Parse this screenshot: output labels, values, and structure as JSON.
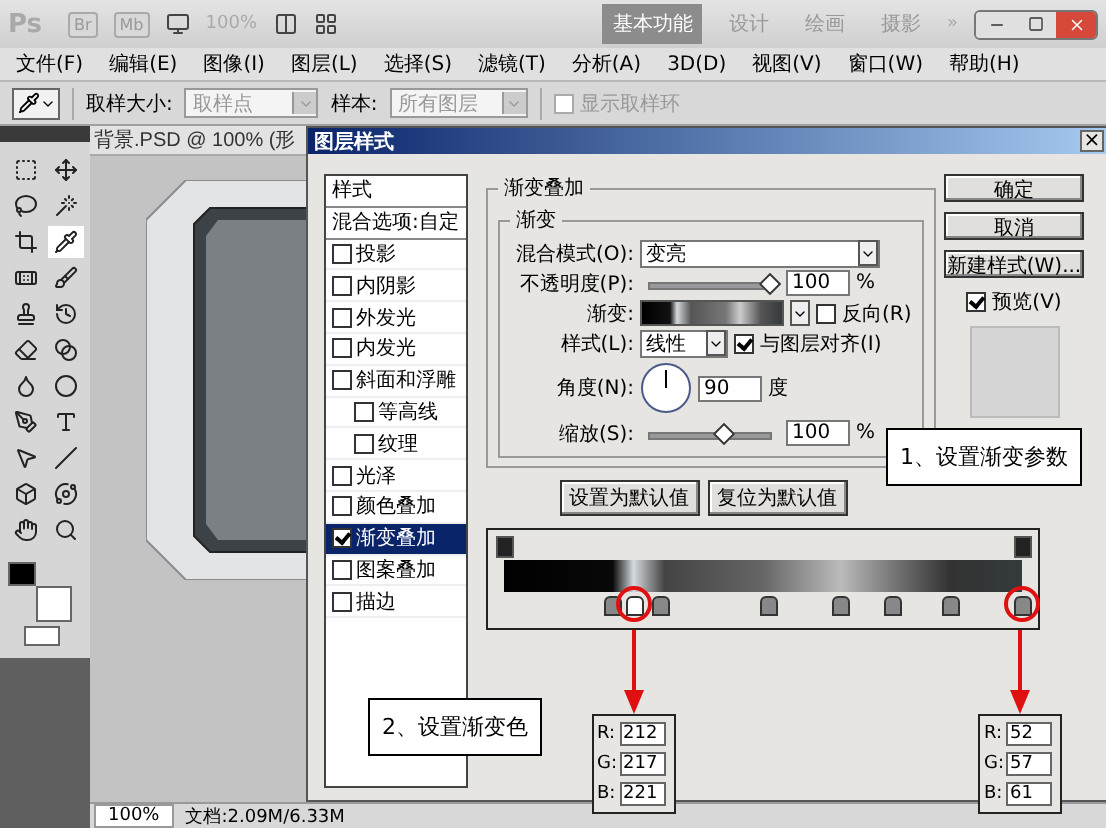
{
  "app_bar": {
    "logo": "Ps",
    "bridge": "Br",
    "mini_bridge": "Mb",
    "zoom": "100%",
    "workspaces": [
      {
        "label": "基本功能",
        "selected": true
      },
      {
        "label": "设计",
        "selected": false
      },
      {
        "label": "绘画",
        "selected": false
      },
      {
        "label": "摄影",
        "selected": false
      }
    ],
    "more": "»"
  },
  "menu": [
    "文件(F)",
    "编辑(E)",
    "图像(I)",
    "图层(L)",
    "选择(S)",
    "滤镜(T)",
    "分析(A)",
    "3D(D)",
    "视图(V)",
    "窗口(W)",
    "帮助(H)"
  ],
  "options_bar": {
    "sample_size_label": "取样大小:",
    "sample_size": "取样点",
    "sample_label": "样本:",
    "sample": "所有图层",
    "show_ring": {
      "label": "显示取样环",
      "checked": false,
      "disabled": true
    }
  },
  "toolbox": {
    "tools": [
      {
        "selected": false
      },
      {
        "selected": false
      },
      {
        "selected": false
      },
      {
        "selected": false
      },
      {
        "selected": false
      },
      {
        "selected": true
      },
      {
        "selected": false
      },
      {
        "selected": false
      },
      {
        "selected": false
      },
      {
        "selected": false
      },
      {
        "selected": false
      },
      {
        "selected": false
      },
      {
        "selected": false
      },
      {
        "selected": false
      },
      {
        "selected": false
      },
      {
        "selected": false
      },
      {
        "selected": false
      },
      {
        "selected": false
      },
      {
        "selected": false
      },
      {
        "selected": false
      },
      {
        "selected": false
      },
      {
        "selected": false
      }
    ]
  },
  "document": {
    "tab": "背景.PSD @ 100% (形",
    "zoom": "100%",
    "doc_info": "文档:2.09M/6.33M"
  },
  "dialog": {
    "title": "图层样式",
    "close": "×",
    "styles": [
      {
        "label": "样式",
        "kind": "header",
        "selected": false
      },
      {
        "label": "混合选项:自定",
        "kind": "header",
        "selected": false
      },
      {
        "label": "投影",
        "kind": "check",
        "checked": false,
        "selected": false
      },
      {
        "label": "内阴影",
        "kind": "check",
        "checked": false,
        "selected": false
      },
      {
        "label": "外发光",
        "kind": "check",
        "checked": false,
        "selected": false
      },
      {
        "label": "内发光",
        "kind": "check",
        "checked": false,
        "selected": false
      },
      {
        "label": "斜面和浮雕",
        "kind": "check",
        "checked": false,
        "selected": false,
        "children": [
          {
            "label": "等高线",
            "kind": "check",
            "checked": false,
            "selected": false
          },
          {
            "label": "纹理",
            "kind": "check",
            "checked": false,
            "selected": false
          }
        ]
      },
      {
        "label": "光泽",
        "kind": "check",
        "checked": false,
        "selected": false
      },
      {
        "label": "颜色叠加",
        "kind": "check",
        "checked": false,
        "selected": false
      },
      {
        "label": "渐变叠加",
        "kind": "check",
        "checked": true,
        "selected": true
      },
      {
        "label": "图案叠加",
        "kind": "check",
        "checked": false,
        "selected": false
      },
      {
        "label": "描边",
        "kind": "check",
        "checked": false,
        "selected": false
      }
    ],
    "panel": {
      "title": "渐变叠加",
      "group": "渐变",
      "blend_mode": {
        "label": "混合模式(O):",
        "value": "变亮"
      },
      "opacity": {
        "label": "不透明度(P):",
        "value": "100",
        "unit": "%",
        "level": 0.97
      },
      "gradient": {
        "label": "渐变:"
      },
      "reverse": {
        "label": "反向(R)",
        "checked": false
      },
      "style": {
        "label": "样式(L):",
        "value": "线性"
      },
      "align": {
        "label": "与图层对齐(I)",
        "checked": true
      },
      "angle": {
        "label": "角度(N):",
        "value": "90",
        "unit": "度"
      },
      "scale": {
        "label": "缩放(S):",
        "value": "100",
        "unit": "%",
        "level": 0.6
      },
      "buttons": [
        "设置为默认值",
        "复位为默认值"
      ]
    },
    "buttons": [
      "确定",
      "取消",
      "新建样式(W)..."
    ],
    "preview": {
      "label": "预览(V)",
      "checked": true
    },
    "gradient_editor": {
      "opacity_stops": [
        {
          "level": 0
        },
        {
          "level": 1
        }
      ],
      "color_stops": [
        {
          "level": 0.21,
          "selected": false,
          "highlighted": false
        },
        {
          "level": 0.25,
          "selected": true,
          "highlighted": true
        },
        {
          "level": 0.3,
          "selected": false,
          "highlighted": false
        },
        {
          "level": 0.51,
          "selected": false,
          "highlighted": false
        },
        {
          "level": 0.65,
          "selected": false,
          "highlighted": false
        },
        {
          "level": 0.75,
          "selected": false,
          "highlighted": false
        },
        {
          "level": 0.86,
          "selected": false,
          "highlighted": false
        },
        {
          "level": 1,
          "selected": false,
          "highlighted": true
        }
      ]
    },
    "color_values": [
      {
        "rows": [
          {
            "label": "R:",
            "value": "212"
          },
          {
            "label": "G:",
            "value": "217"
          },
          {
            "label": "B:",
            "value": "221"
          }
        ]
      },
      {
        "rows": [
          {
            "label": "R:",
            "value": "52"
          },
          {
            "label": "G:",
            "value": "57"
          },
          {
            "label": "B:",
            "value": "61"
          }
        ]
      }
    ],
    "callouts": [
      {
        "text": "1、设置渐变参数"
      },
      {
        "text": "2、设置渐变色"
      }
    ]
  }
}
